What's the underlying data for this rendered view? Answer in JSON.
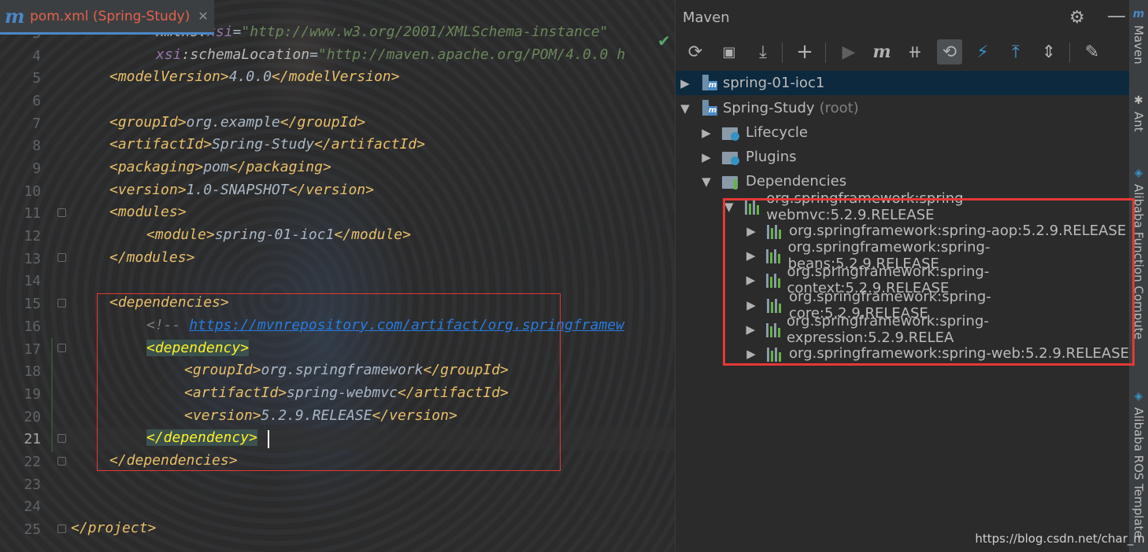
{
  "editor": {
    "tab": {
      "icon": "maven-m-icon",
      "title": "pom.xml (Spring-Study)",
      "close": "✕"
    },
    "line_numbers": [
      "3",
      "4",
      "5",
      "6",
      "7",
      "8",
      "9",
      "10",
      "11",
      "12",
      "13",
      "14",
      "15",
      "16",
      "17",
      "18",
      "19",
      "20",
      "21",
      "22",
      "23",
      "24",
      "25"
    ],
    "current_line": "21",
    "lines": {
      "l3": {
        "attr": "xmlns:",
        "ns": "xsi",
        "eq": "=",
        "str": "\"http://www.w3.org/2001/XMLSchema-instance\""
      },
      "l4": {
        "ns": "xsi",
        "attr": ":schemaLocation",
        "eq": "=",
        "str": "\"http://maven.apache.org/POM/4.0.0 h"
      },
      "l5": {
        "open": "<modelVersion>",
        "text": "4.0.0",
        "close": "</modelVersion>"
      },
      "l7": {
        "open": "<groupId>",
        "text": "org.example",
        "close": "</groupId>"
      },
      "l8": {
        "open": "<artifactId>",
        "text": "Spring-Study",
        "close": "</artifactId>"
      },
      "l9": {
        "open": "<packaging>",
        "text": "pom",
        "close": "</packaging>"
      },
      "l10": {
        "open": "<version>",
        "text": "1.0-SNAPSHOT",
        "close": "</version>"
      },
      "l11": {
        "open": "<modules>"
      },
      "l12": {
        "open": "<module>",
        "text": "spring-01-ioc1",
        "close": "</module>"
      },
      "l13": {
        "close": "</modules>"
      },
      "l15": {
        "open": "<dependencies>"
      },
      "l16": {
        "cmt": "<!-- ",
        "link": "https://mvnrepository.com/artifact/org.springframew"
      },
      "l17": {
        "open": "<dependency>"
      },
      "l18": {
        "open": "<groupId>",
        "text": "org.springframework",
        "close": "</groupId>"
      },
      "l19": {
        "open": "<artifactId>",
        "text": "spring-webmvc",
        "close": "</artifactId>"
      },
      "l20": {
        "open": "<version>",
        "text": "5.2.9.RELEASE",
        "close": "</version>"
      },
      "l21": {
        "close": "</dependency>"
      },
      "l22": {
        "close": "</dependencies>"
      },
      "l25": {
        "close": "</project>"
      }
    },
    "inspection_icon": "check-icon"
  },
  "maven": {
    "title": "Maven",
    "header_icons": [
      "gear-icon",
      "minimize-icon"
    ],
    "toolbar": [
      {
        "name": "reload-icon",
        "glyph": "⟳"
      },
      {
        "name": "generate-sources-icon",
        "glyph": "📁"
      },
      {
        "name": "download-icon",
        "glyph": "⤓"
      },
      {
        "name": "add-icon",
        "glyph": "+"
      },
      {
        "name": "run-icon",
        "glyph": "▶"
      },
      {
        "name": "execute-goal-icon",
        "glyph": "m"
      },
      {
        "name": "skip-tests-icon",
        "glyph": "⫲"
      },
      {
        "name": "show-dependencies-icon",
        "glyph": "⟲"
      },
      {
        "name": "offline-icon",
        "glyph": "⚡"
      },
      {
        "name": "expand-all-icon",
        "glyph": "⤒"
      },
      {
        "name": "collapse-all-icon",
        "glyph": "⇕"
      },
      {
        "name": "settings-icon",
        "glyph": "🔧"
      }
    ],
    "tree": [
      {
        "label": "spring-01-ioc1",
        "arrow": "▶",
        "icon": "maven-module-icon"
      },
      {
        "label": "Spring-Study",
        "suffix": "(root)",
        "arrow": "▼",
        "icon": "maven-module-icon"
      },
      {
        "label": "Lifecycle",
        "arrow": "▶",
        "icon": "folder-gear-icon"
      },
      {
        "label": "Plugins",
        "arrow": "▶",
        "icon": "folder-gear-icon"
      },
      {
        "label": "Dependencies",
        "arrow": "▼",
        "icon": "library-folder-icon"
      },
      {
        "label": "org.springframework:spring-webmvc:5.2.9.RELEASE",
        "arrow": "▼",
        "icon": "library-icon"
      },
      {
        "label": "org.springframework:spring-aop:5.2.9.RELEASE",
        "arrow": "▶",
        "icon": "library-icon"
      },
      {
        "label": "org.springframework:spring-beans:5.2.9.RELEASE",
        "arrow": "▶",
        "icon": "library-icon"
      },
      {
        "label": "org.springframework:spring-context:5.2.9.RELEASE",
        "arrow": "▶",
        "icon": "library-icon"
      },
      {
        "label": "org.springframework:spring-core:5.2.9.RELEASE",
        "arrow": "▶",
        "icon": "library-icon"
      },
      {
        "label": "org.springframework:spring-expression:5.2.9.RELEA",
        "arrow": "▶",
        "icon": "library-icon"
      },
      {
        "label": "org.springframework:spring-web:5.2.9.RELEASE",
        "arrow": "▶",
        "icon": "library-icon"
      }
    ]
  },
  "side_tabs": [
    {
      "label": "Maven",
      "icon": "maven-m-icon"
    },
    {
      "label": "Ant",
      "icon": "ant-icon"
    },
    {
      "label": "Alibaba Function Compute",
      "icon": "alibaba-icon"
    },
    {
      "label": "Alibaba ROS Template",
      "icon": "alibaba-icon"
    }
  ],
  "watermark": "https://blog.csdn.net/char_m",
  "colors": {
    "highlight_box": "#e53935",
    "tag": "#e8bf6a",
    "string": "#6a8759",
    "link": "#287bde",
    "selection": "#0d293e"
  }
}
